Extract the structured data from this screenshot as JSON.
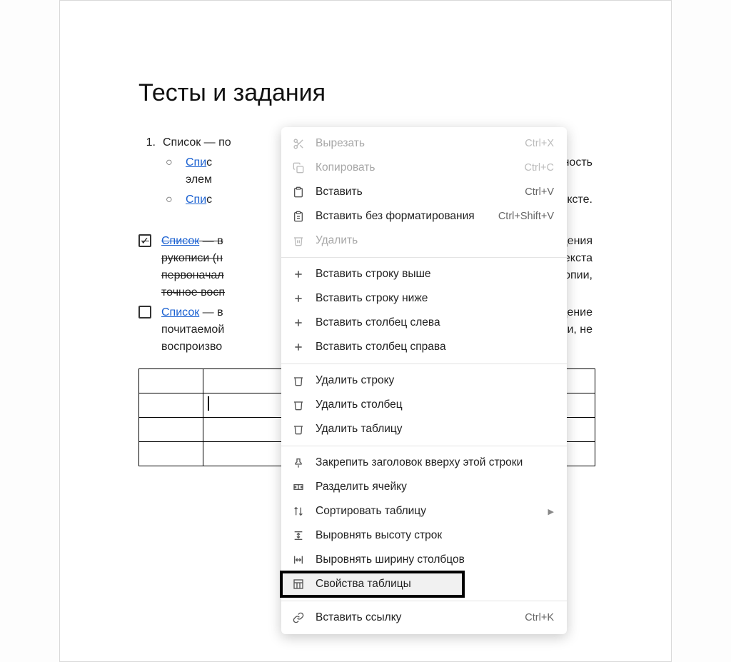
{
  "doc": {
    "title": "Тесты и задания",
    "item1_num": "1.",
    "item1_prefix": "Список",
    "item1_rest": " — по",
    "sub1_link": "Спи",
    "sub1_rest_line1": "с",
    "sub1_tail": "ательность",
    "sub1_line2": "элем",
    "sub2_link": "Спи",
    "sub2_rest": "с",
    "sub2_tail": "ексте.",
    "check1_link": "Список",
    "check1_line1_rest": " — в",
    "check1_line1_tail": "изведения",
    "check1_line2": "рукописи (н",
    "check1_line2_tail": "екста",
    "check1_line3": "первоначал",
    "check1_line3_tail": "ие от копии,",
    "check1_line4": "точное восп",
    "check2_link": "Список",
    "check2_line1_rest": " — в",
    "check2_line1_tail": "дение",
    "check2_line2": "почитаемой",
    "check2_line2_tail": "ии, не",
    "check2_line3": "воспроизво"
  },
  "menu": {
    "cut": "Вырезать",
    "cut_kbd": "Ctrl+X",
    "copy": "Копировать",
    "copy_kbd": "Ctrl+C",
    "paste": "Вставить",
    "paste_kbd": "Ctrl+V",
    "paste_plain": "Вставить без форматирования",
    "paste_plain_kbd": "Ctrl+Shift+V",
    "delete": "Удалить",
    "row_above": "Вставить строку выше",
    "row_below": "Вставить строку ниже",
    "col_left": "Вставить столбец слева",
    "col_right": "Вставить столбец справа",
    "del_row": "Удалить строку",
    "del_col": "Удалить столбец",
    "del_table": "Удалить таблицу",
    "pin_header": "Закрепить заголовок вверху этой строки",
    "split_cell": "Разделить ячейку",
    "sort_table": "Сортировать таблицу",
    "dist_rows": "Выровнять высоту строк",
    "dist_cols": "Выровнять ширину столбцов",
    "table_props": "Свойства таблицы",
    "insert_link": "Вставить ссылку",
    "insert_link_kbd": "Ctrl+K"
  }
}
